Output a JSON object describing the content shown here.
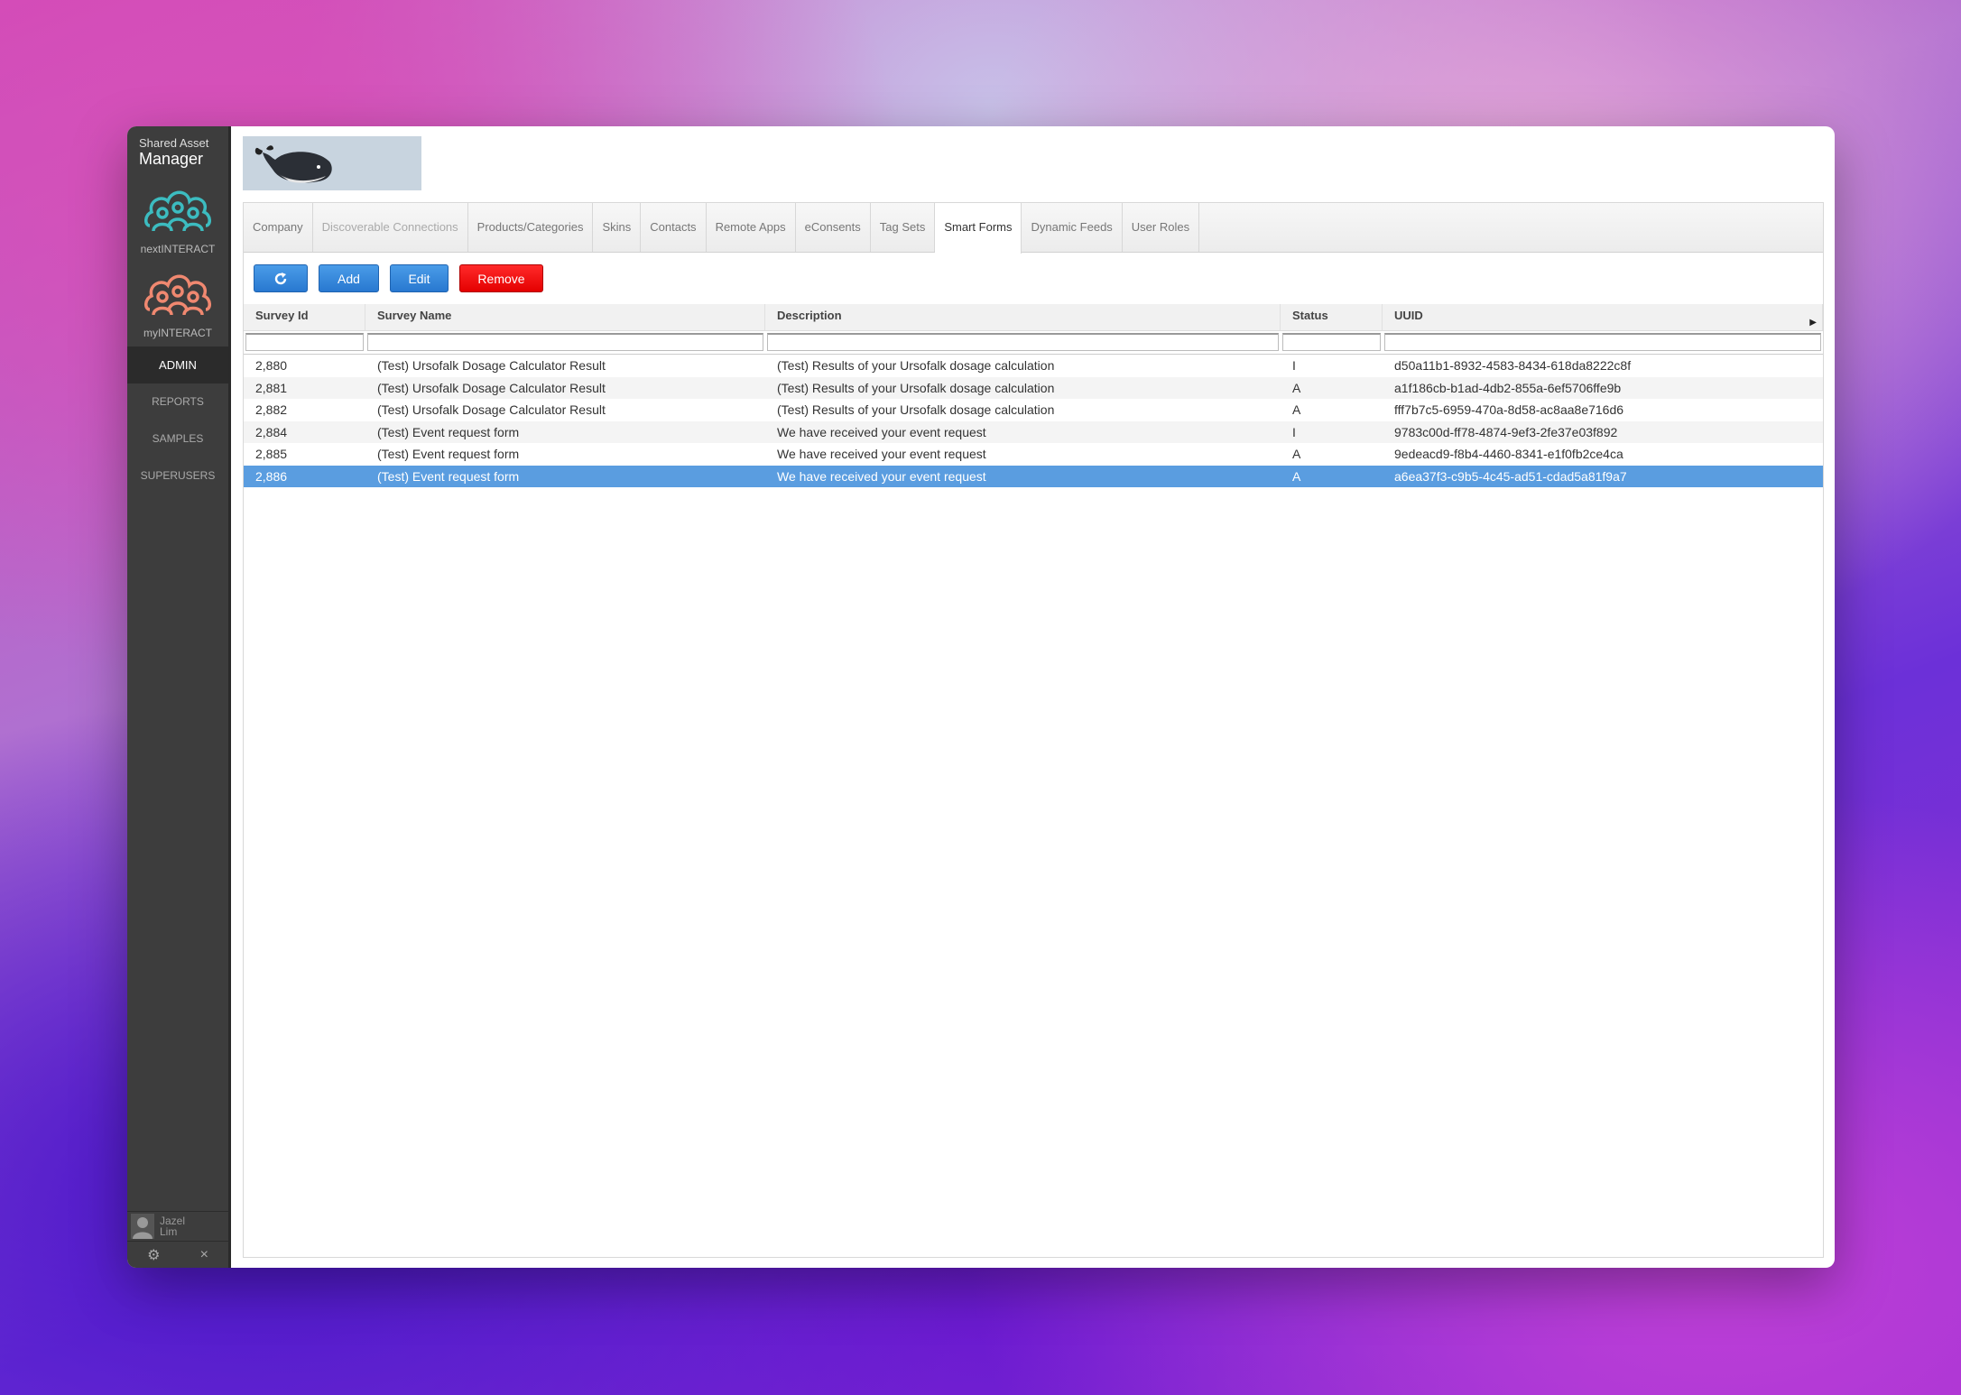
{
  "sidebar": {
    "brand_small": "Shared Asset",
    "brand_big": "Manager",
    "apps": [
      {
        "label": "nextINTERACT",
        "color": "#3cbcc0"
      },
      {
        "label": "myINTERACT",
        "color": "#f08870"
      }
    ],
    "nav": [
      {
        "label": "ADMIN",
        "active": true
      },
      {
        "label": "REPORTS"
      },
      {
        "label": "SAMPLES"
      },
      {
        "label": "SUPERUSERS"
      }
    ],
    "user_first": "Jazel",
    "user_last": "Lim",
    "footer_icons": [
      "gear-icon",
      "close-icon"
    ]
  },
  "tabs": [
    {
      "label": "Company"
    },
    {
      "label": "Discoverable Connections",
      "disabled": true
    },
    {
      "label": "Products/Categories"
    },
    {
      "label": "Skins"
    },
    {
      "label": "Contacts"
    },
    {
      "label": "Remote Apps"
    },
    {
      "label": "eConsents"
    },
    {
      "label": "Tag Sets"
    },
    {
      "label": "Smart Forms",
      "active": true
    },
    {
      "label": "Dynamic Feeds"
    },
    {
      "label": "User Roles"
    }
  ],
  "toolbar": {
    "add_label": "Add",
    "edit_label": "Edit",
    "remove_label": "Remove"
  },
  "grid": {
    "columns": [
      "Survey Id",
      "Survey Name",
      "Description",
      "Status",
      "UUID"
    ],
    "rows": [
      [
        "2,880",
        "(Test) Ursofalk Dosage Calculator Result",
        "(Test) Results of your Ursofalk dosage calculation",
        "I",
        "d50a11b1-8932-4583-8434-618da8222c8f"
      ],
      [
        "2,881",
        "(Test) Ursofalk Dosage Calculator Result",
        "(Test) Results of your Ursofalk dosage calculation",
        "A",
        "a1f186cb-b1ad-4db2-855a-6ef5706ffe9b"
      ],
      [
        "2,882",
        "(Test) Ursofalk Dosage Calculator Result",
        "(Test) Results of your Ursofalk dosage calculation",
        "A",
        "fff7b7c5-6959-470a-8d58-ac8aa8e716d6"
      ],
      [
        "2,884",
        "(Test) Event request form",
        "We have received your event request",
        "I",
        "9783c00d-ff78-4874-9ef3-2fe37e03f892"
      ],
      [
        "2,885",
        "(Test) Event request form",
        "We have received your event request",
        "A",
        "9edeacd9-f8b4-4460-8341-e1f0fb2ce4ca"
      ],
      [
        "2,886",
        "(Test) Event request form",
        "We have received your event request",
        "A",
        "a6ea37f3-c9b5-4c45-ad51-cdad5a81f9a7"
      ]
    ],
    "selected_row": 5
  }
}
